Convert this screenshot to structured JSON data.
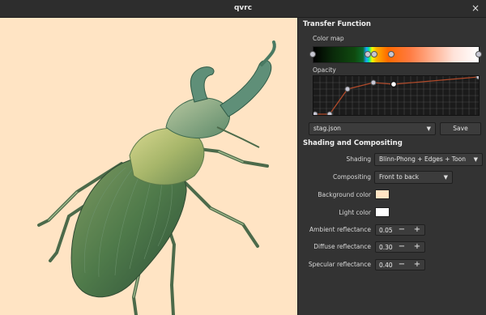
{
  "window": {
    "title": "qvrc",
    "close_glyph": "×"
  },
  "viewport": {
    "background_color": "#ffe4c4",
    "subject": "stag beetle volume rendering"
  },
  "panel": {
    "transfer_function": {
      "title": "Transfer Function",
      "color_map_label": "Color map",
      "opacity_label": "Opacity",
      "preset_value": "stag.json",
      "save_label": "Save"
    },
    "shading": {
      "title": "Shading and Compositing",
      "shading_label": "Shading",
      "shading_value": "Blinn-Phong + Edges + Toon",
      "compositing_label": "Compositing",
      "compositing_value": "Front to back",
      "background_color_label": "Background color",
      "background_color": "#ffe4c4",
      "light_color_label": "Light color",
      "light_color": "#ffffff",
      "ambient_label": "Ambient reflectance",
      "ambient_value": "0.05",
      "diffuse_label": "Diffuse reflectance",
      "diffuse_value": "0.30",
      "specular_label": "Specular reflectance",
      "specular_value": "0.40",
      "minus_glyph": "−",
      "plus_glyph": "+"
    }
  },
  "icons": {
    "dropdown": "chevron-down-icon",
    "close": "close-icon"
  }
}
